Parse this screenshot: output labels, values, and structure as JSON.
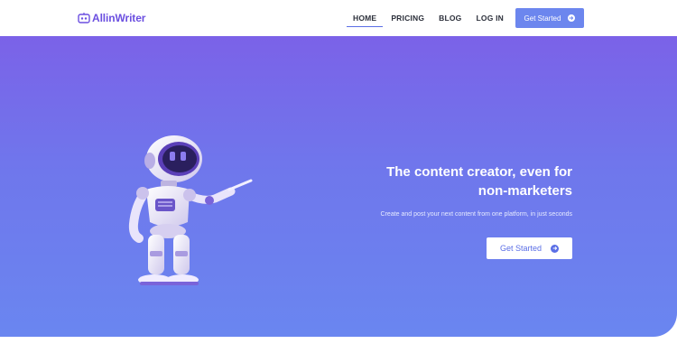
{
  "header": {
    "logo_text": "AllinWriter",
    "nav": [
      {
        "label": "HOME",
        "active": true
      },
      {
        "label": "PRICING",
        "active": false
      },
      {
        "label": "BLOG",
        "active": false
      },
      {
        "label": "LOG IN",
        "active": false
      }
    ],
    "cta_label": "Get Started",
    "cta_icon": "arrow-right-circle-icon"
  },
  "hero": {
    "headline_line1": "The content creator, even for",
    "headline_line2": "non-marketers",
    "subline": "Create and post your next content from one platform, in just seconds",
    "cta_label": "Get Started",
    "cta_icon": "arrow-right-circle-icon",
    "illustration": "robot-illustration"
  },
  "colors": {
    "brand": "#6b4fe0",
    "accent": "#6c86ee",
    "hero_top": "#7b62e8",
    "hero_bottom": "#6a86f0"
  }
}
